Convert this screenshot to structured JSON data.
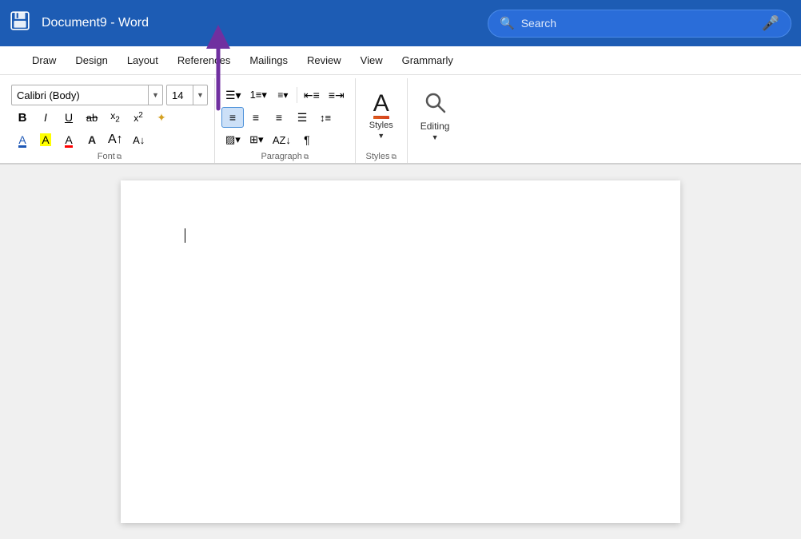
{
  "titlebar": {
    "save_icon": "💾",
    "title": "Document9  -  Word",
    "search_placeholder": "Search"
  },
  "menu": {
    "items": [
      "",
      "Draw",
      "Design",
      "Layout",
      "References",
      "Mailings",
      "Review",
      "View",
      "Grammarly"
    ]
  },
  "ribbon": {
    "font_name": "Calibri (Body)",
    "font_size": "14",
    "buttons": {
      "bold": "B",
      "italic": "I",
      "underline": "U",
      "strikethrough": "ab",
      "subscript": "x",
      "superscript": "x²",
      "format_painter": "✦"
    },
    "paragraph_label": "Paragraph",
    "font_label": "Font",
    "styles_label": "Styles",
    "editing_label": "Editing"
  },
  "arrow": {
    "visible": true
  },
  "document": {
    "cursor_visible": true
  }
}
